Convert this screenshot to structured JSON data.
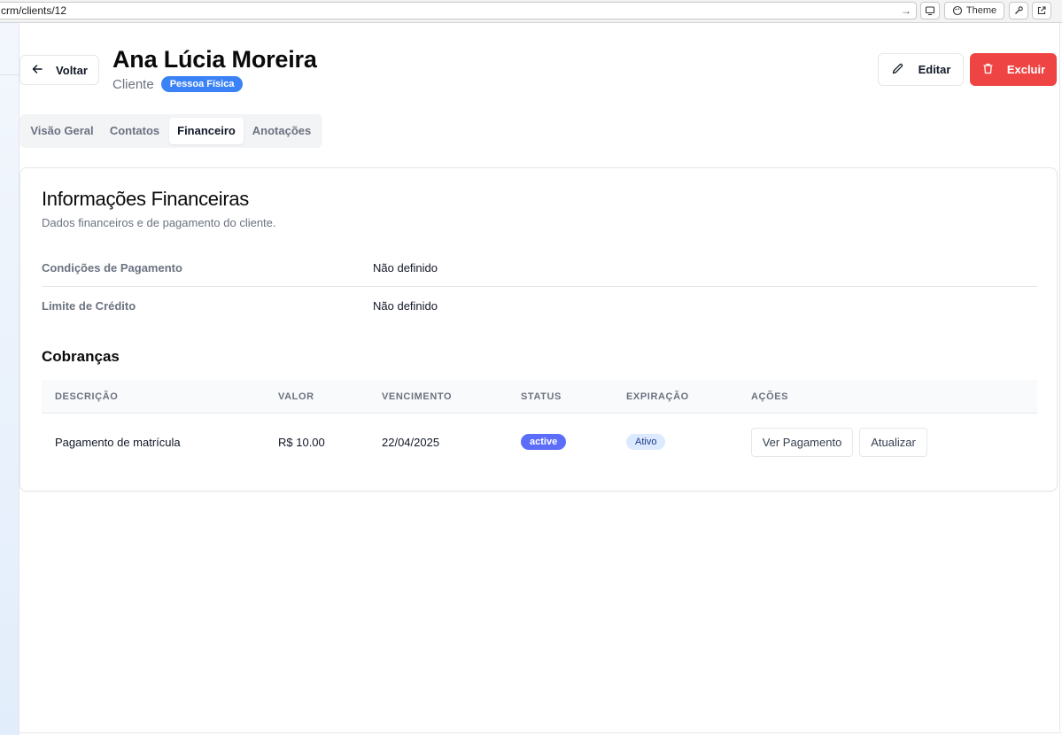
{
  "browser": {
    "url": "crm/clients/12",
    "theme_label": "Theme"
  },
  "header": {
    "back_label": "Voltar",
    "client_name": "Ana Lúcia Moreira",
    "client_role": "Cliente",
    "client_type_badge": "Pessoa Física",
    "edit_label": "Editar",
    "delete_label": "Excluir"
  },
  "tabs": [
    {
      "label": "Visão Geral",
      "active": false
    },
    {
      "label": "Contatos",
      "active": false
    },
    {
      "label": "Financeiro",
      "active": true
    },
    {
      "label": "Anotações",
      "active": false
    }
  ],
  "financial": {
    "title": "Informações Financeiras",
    "description": "Dados financeiros e de pagamento do cliente.",
    "fields": [
      {
        "label": "Condições de Pagamento",
        "value": "Não definido"
      },
      {
        "label": "Limite de Crédito",
        "value": "Não definido"
      }
    ]
  },
  "charges": {
    "title": "Cobranças",
    "columns": [
      "Descrição",
      "Valor",
      "Vencimento",
      "Status",
      "Expiração",
      "Ações"
    ],
    "rows": [
      {
        "descricao": "Pagamento de matrícula",
        "valor": "R$ 10.00",
        "vencimento": "22/04/2025",
        "status": "active",
        "expiracao": "Ativo",
        "actions": [
          "Ver Pagamento",
          "Atualizar"
        ]
      }
    ]
  },
  "colors": {
    "delete": "#ef4444",
    "type_badge": "#3b82f6",
    "status_active": "#5c6ef8",
    "expiration_badge_bg": "#dbeafe"
  },
  "icons": {
    "back": "arrow-left-icon",
    "edit": "pencil-icon",
    "delete": "trash-icon",
    "url_go": "arrow-right-icon",
    "theme": "palette-icon"
  }
}
